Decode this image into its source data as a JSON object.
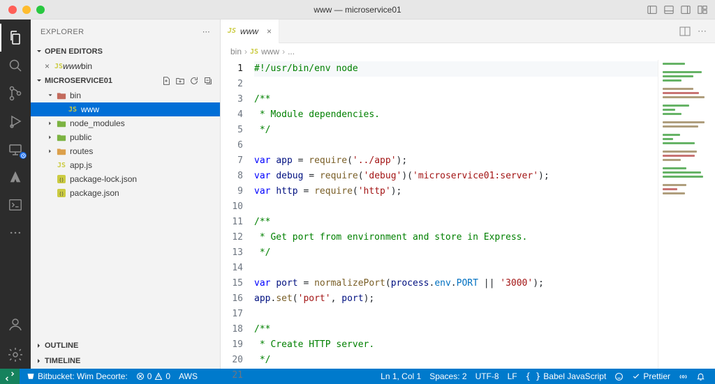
{
  "window": {
    "title": "www — microservice01"
  },
  "activity_icons": [
    "files",
    "search",
    "source-control",
    "run",
    "remote",
    "testing",
    "terminal-sq",
    "more"
  ],
  "activity_bottom": [
    "account",
    "settings"
  ],
  "sidebar": {
    "title": "EXPLORER",
    "open_editors_label": "OPEN EDITORS",
    "open_editors": [
      {
        "name": "www",
        "dim": "bin",
        "icon": "js"
      }
    ],
    "workspace_label": "MICROSERVICE01",
    "tree": [
      {
        "type": "folder",
        "name": "bin",
        "expanded": true,
        "indent": 1,
        "iconStyle": "special"
      },
      {
        "type": "file",
        "name": "www",
        "indent": 2,
        "icon": "js",
        "selected": true
      },
      {
        "type": "folder",
        "name": "node_modules",
        "expanded": false,
        "indent": 1,
        "iconStyle": "green"
      },
      {
        "type": "folder",
        "name": "public",
        "expanded": false,
        "indent": 1,
        "iconStyle": "green"
      },
      {
        "type": "folder",
        "name": "routes",
        "expanded": false,
        "indent": 1
      },
      {
        "type": "file",
        "name": "app.js",
        "indent": 1,
        "icon": "js"
      },
      {
        "type": "file",
        "name": "package-lock.json",
        "indent": 1,
        "icon": "json"
      },
      {
        "type": "file",
        "name": "package.json",
        "indent": 1,
        "icon": "json"
      }
    ],
    "outline_label": "OUTLINE",
    "timeline_label": "TIMELINE"
  },
  "tabs": {
    "items": [
      {
        "name": "www",
        "icon": "js"
      }
    ]
  },
  "breadcrumbs": {
    "parts": [
      "bin",
      "www",
      "..."
    ],
    "js_label": "JS"
  },
  "code": {
    "lines": [
      {
        "segments": [
          {
            "t": "#!/usr/bin/env node",
            "c": "tok-sh"
          }
        ],
        "current": true
      },
      {
        "segments": []
      },
      {
        "segments": [
          {
            "t": "/**",
            "c": "tok-cmt"
          }
        ]
      },
      {
        "segments": [
          {
            "t": " * Module dependencies.",
            "c": "tok-cmt"
          }
        ]
      },
      {
        "segments": [
          {
            "t": " */",
            "c": "tok-cmt"
          }
        ]
      },
      {
        "segments": []
      },
      {
        "segments": [
          {
            "t": "var ",
            "c": "tok-kw"
          },
          {
            "t": "app",
            "c": "tok-var"
          },
          {
            "t": " = "
          },
          {
            "t": "require",
            "c": "tok-fn"
          },
          {
            "t": "("
          },
          {
            "t": "'../app'",
            "c": "tok-str"
          },
          {
            "t": ");"
          }
        ]
      },
      {
        "segments": [
          {
            "t": "var ",
            "c": "tok-kw"
          },
          {
            "t": "debug",
            "c": "tok-var"
          },
          {
            "t": " = "
          },
          {
            "t": "require",
            "c": "tok-fn"
          },
          {
            "t": "("
          },
          {
            "t": "'debug'",
            "c": "tok-str"
          },
          {
            "t": ")("
          },
          {
            "t": "'microservice01:server'",
            "c": "tok-str"
          },
          {
            "t": ");"
          }
        ]
      },
      {
        "segments": [
          {
            "t": "var ",
            "c": "tok-kw"
          },
          {
            "t": "http",
            "c": "tok-var"
          },
          {
            "t": " = "
          },
          {
            "t": "require",
            "c": "tok-fn"
          },
          {
            "t": "("
          },
          {
            "t": "'http'",
            "c": "tok-str"
          },
          {
            "t": ");"
          }
        ]
      },
      {
        "segments": []
      },
      {
        "segments": [
          {
            "t": "/**",
            "c": "tok-cmt"
          }
        ]
      },
      {
        "segments": [
          {
            "t": " * Get port from environment and store in Express.",
            "c": "tok-cmt"
          }
        ]
      },
      {
        "segments": [
          {
            "t": " */",
            "c": "tok-cmt"
          }
        ]
      },
      {
        "segments": []
      },
      {
        "segments": [
          {
            "t": "var ",
            "c": "tok-kw"
          },
          {
            "t": "port",
            "c": "tok-var"
          },
          {
            "t": " = "
          },
          {
            "t": "normalizePort",
            "c": "tok-fn"
          },
          {
            "t": "("
          },
          {
            "t": "process",
            "c": "tok-var"
          },
          {
            "t": "."
          },
          {
            "t": "env",
            "c": "tok-prop"
          },
          {
            "t": "."
          },
          {
            "t": "PORT",
            "c": "tok-prop"
          },
          {
            "t": " || "
          },
          {
            "t": "'3000'",
            "c": "tok-str"
          },
          {
            "t": ");"
          }
        ]
      },
      {
        "segments": [
          {
            "t": "app",
            "c": "tok-var"
          },
          {
            "t": "."
          },
          {
            "t": "set",
            "c": "tok-fn"
          },
          {
            "t": "("
          },
          {
            "t": "'port'",
            "c": "tok-str"
          },
          {
            "t": ", "
          },
          {
            "t": "port",
            "c": "tok-var"
          },
          {
            "t": ");"
          }
        ]
      },
      {
        "segments": []
      },
      {
        "segments": [
          {
            "t": "/**",
            "c": "tok-cmt"
          }
        ]
      },
      {
        "segments": [
          {
            "t": " * Create HTTP server.",
            "c": "tok-cmt"
          }
        ]
      },
      {
        "segments": [
          {
            "t": " */",
            "c": "tok-cmt"
          }
        ]
      },
      {
        "segments": []
      }
    ]
  },
  "statusbar": {
    "left": {
      "bitbucket": "Bitbucket: Wim Decorte:",
      "errors": "0",
      "warnings": "0",
      "aws": "AWS"
    },
    "right": {
      "cursor": "Ln 1, Col 1",
      "spaces": "Spaces: 2",
      "encoding": "UTF-8",
      "eol": "LF",
      "lang": "Babel JavaScript",
      "prettier": "Prettier"
    }
  }
}
